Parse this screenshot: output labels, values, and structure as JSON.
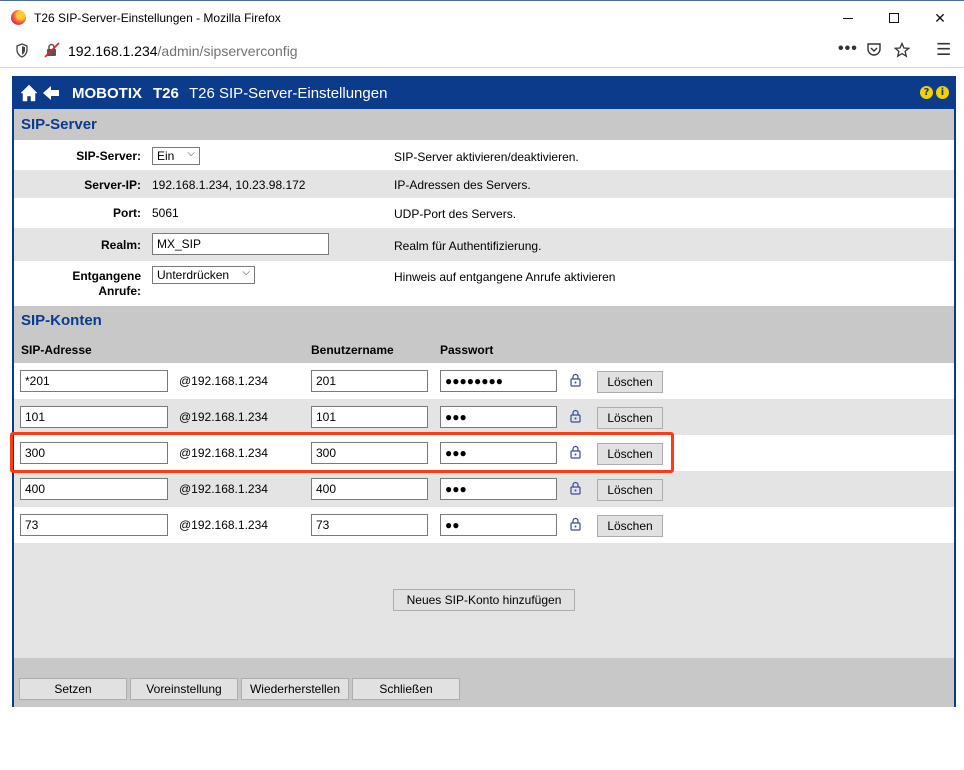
{
  "browser": {
    "window_title": "T26 SIP-Server-Einstellungen - Mozilla Firefox",
    "url_host": "192.168.1.234",
    "url_path": "/admin/sipserverconfig"
  },
  "header": {
    "brand": "MOBOTIX",
    "model": "T26",
    "title": "T26 SIP-Server-Einstellungen",
    "help_glyph": "?",
    "info_glyph": "i",
    "bar_color": "#0c3b8c"
  },
  "sip_server": {
    "section_title": "SIP-Server",
    "fields": {
      "server": {
        "label": "SIP-Server:",
        "value": "Ein",
        "desc": "SIP-Server aktivieren/deaktivieren."
      },
      "ip": {
        "label": "Server-IP:",
        "value": "192.168.1.234, 10.23.98.172",
        "desc": "IP-Adressen des Servers."
      },
      "port": {
        "label": "Port:",
        "value": "5061",
        "desc": "UDP-Port des Servers."
      },
      "realm": {
        "label": "Realm:",
        "value": "MX_SIP",
        "desc": "Realm für Authentifizierung."
      },
      "missed": {
        "label_line1": "Entgangene",
        "label_line2": "Anrufe:",
        "value": "Unterdrücken",
        "desc": "Hinweis auf entgangene Anrufe aktivieren"
      }
    }
  },
  "sip_accounts": {
    "section_title": "SIP-Konten",
    "col_address": "SIP-Adresse",
    "col_user": "Benutzername",
    "col_password": "Passwort",
    "domain": "@192.168.1.234",
    "delete_label": "Löschen",
    "rows": [
      {
        "address": "*201",
        "user": "201",
        "password": "●●●●●●●●"
      },
      {
        "address": "101",
        "user": "101",
        "password": "●●●"
      },
      {
        "address": "300",
        "user": "300",
        "password": "●●●"
      },
      {
        "address": "400",
        "user": "400",
        "password": "●●●"
      },
      {
        "address": "73",
        "user": "73",
        "password": "●●"
      }
    ],
    "add_label": "Neues SIP-Konto hinzufügen",
    "highlight_color": "#ff3b16"
  },
  "footer": {
    "set": "Setzen",
    "defaults": "Voreinstellung",
    "restore": "Wiederherstellen",
    "close": "Schließen"
  }
}
